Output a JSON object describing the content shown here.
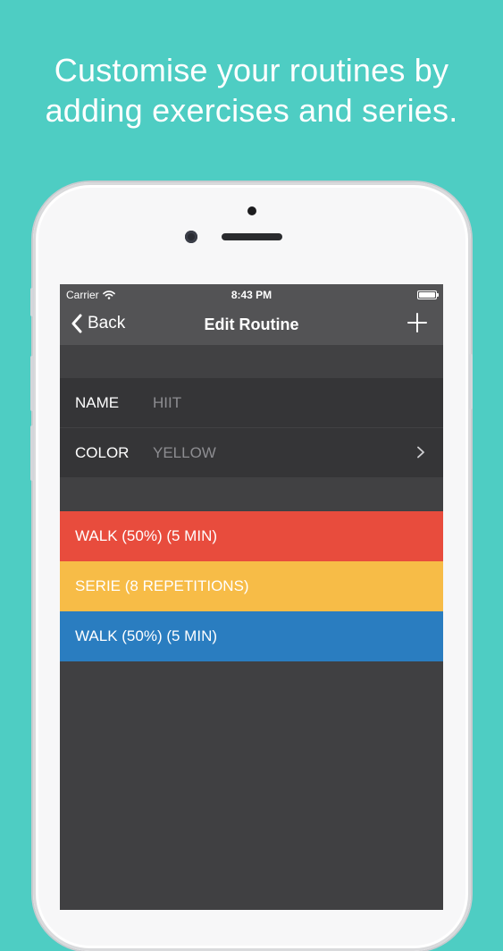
{
  "headline": {
    "line1": "Customise your routines by",
    "line2": "adding exercises and series."
  },
  "status_bar": {
    "carrier": "Carrier",
    "time": "8:43 PM",
    "battery_level": 1.0
  },
  "nav_bar": {
    "back_label": "Back",
    "title": "Edit Routine",
    "add_icon": "plus-icon"
  },
  "form": {
    "name_label": "NAME",
    "name_value": "HIIT",
    "color_label": "COLOR",
    "color_value": "YELLOW",
    "chevron_icon": "chevron-right-icon"
  },
  "exercises": [
    {
      "label": "WALK (50%) (5 MIN)",
      "color": "#e84c3d"
    },
    {
      "label": "SERIE (8 REPETITIONS)",
      "color": "#f7bc47"
    },
    {
      "label": "WALK (50%) (5 MIN)",
      "color": "#2a7dc0"
    }
  ],
  "colors": {
    "background": "#4ecdc3",
    "screen_background": "#404042",
    "bar_background": "#535355"
  }
}
